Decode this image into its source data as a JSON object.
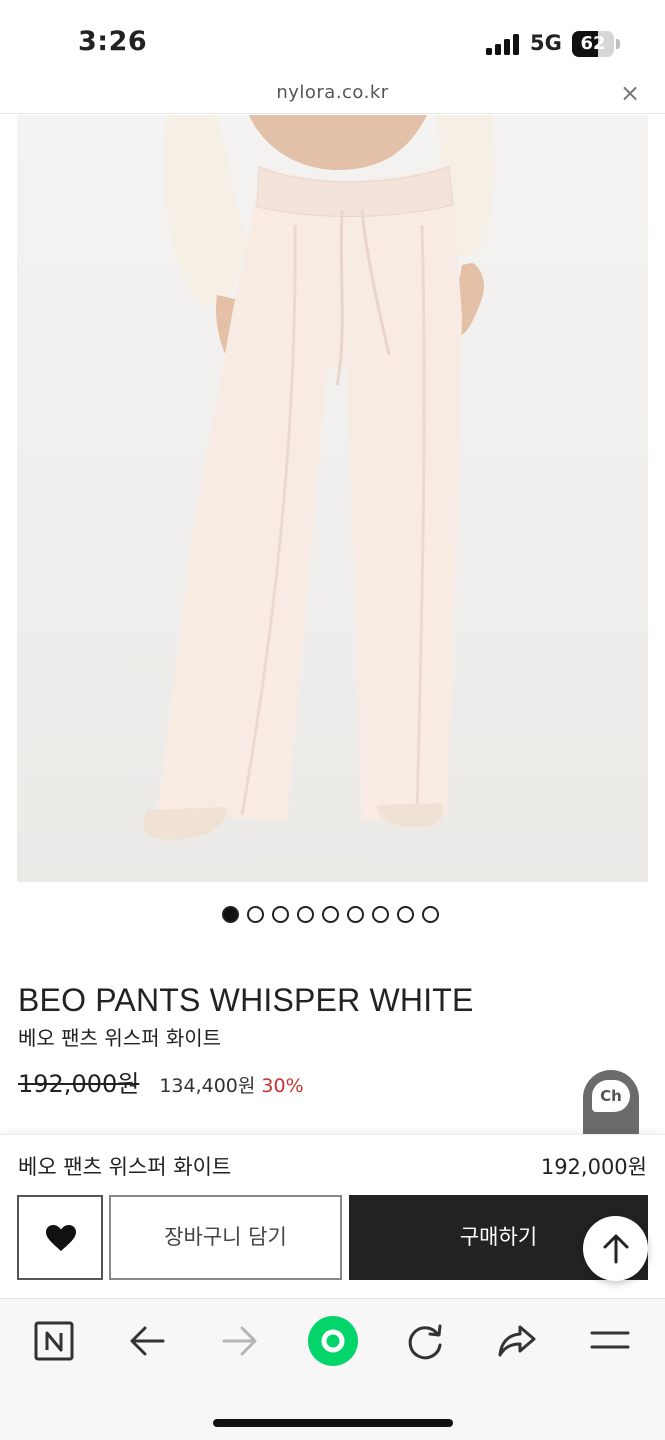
{
  "status_bar": {
    "time": "3:26",
    "network": "5G",
    "battery": "62",
    "battery_level": 0.62
  },
  "url_bar": {
    "url": "nylora.co.kr",
    "close_glyph": "×"
  },
  "gallery": {
    "total_images": 9,
    "active_index": 0
  },
  "product": {
    "title": "BEO PANTS WHISPER WHITE",
    "subtitle": "베오 팬츠 위스퍼 화이트",
    "original_price": "192,000원",
    "sale_price": "134,400원",
    "discount": "30%"
  },
  "chat": {
    "label": "Ch"
  },
  "purchase_panel": {
    "name": "베오 팬츠 위스퍼 화이트",
    "price": "192,000원",
    "wishlist_icon": "heart-icon",
    "cart_label": "장바구니 담기",
    "buy_label": "구매하기",
    "scroll_top_icon": "arrow-up-icon"
  },
  "toolbar": {
    "items": [
      "naver-icon",
      "back-icon",
      "forward-icon",
      "green-dot-icon",
      "refresh-icon",
      "share-icon",
      "menu-icon"
    ]
  },
  "colors": {
    "accent_discount": "#c8322f",
    "buy_button": "#222222",
    "naver_green": "#03d56b"
  }
}
